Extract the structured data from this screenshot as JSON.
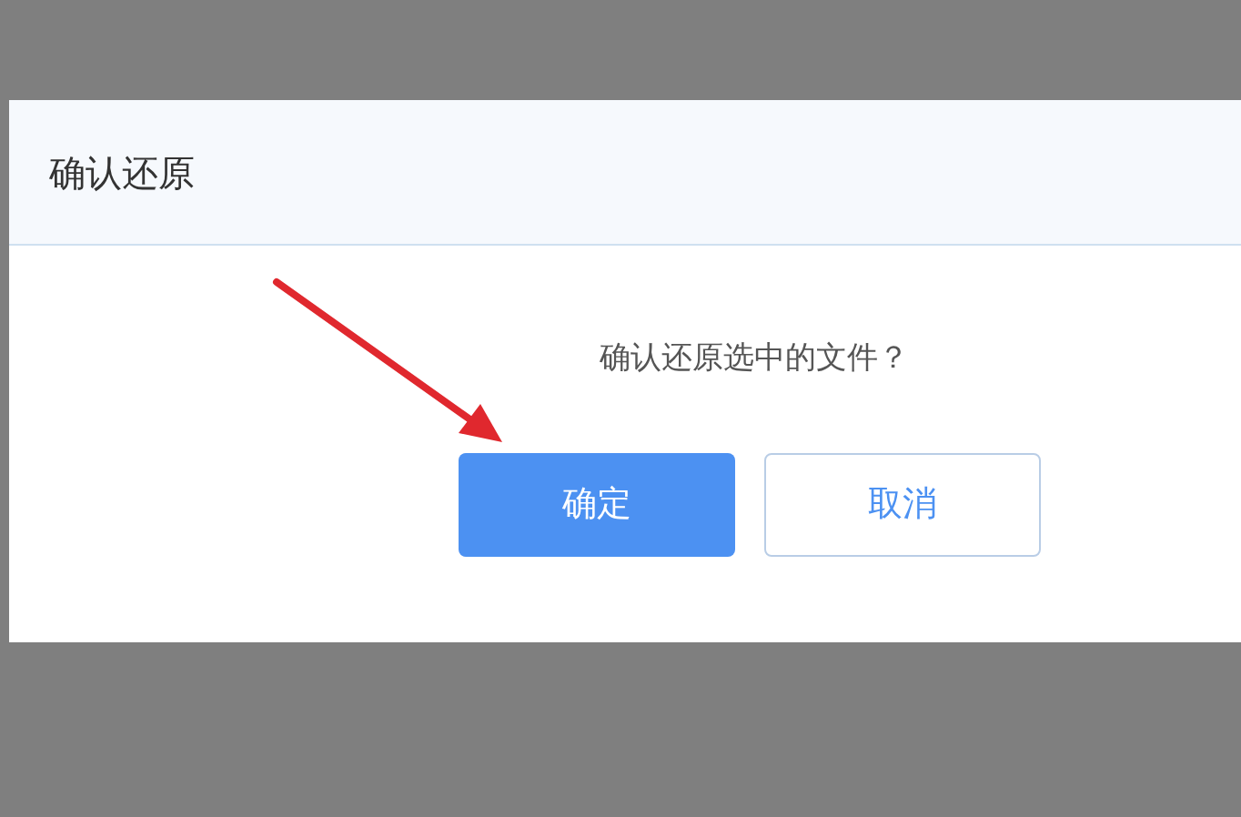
{
  "dialog": {
    "title": "确认还原",
    "message": "确认还原选中的文件？",
    "buttons": [
      {
        "label": "确定",
        "kind": "primary"
      },
      {
        "label": "取消",
        "kind": "secondary"
      }
    ]
  }
}
